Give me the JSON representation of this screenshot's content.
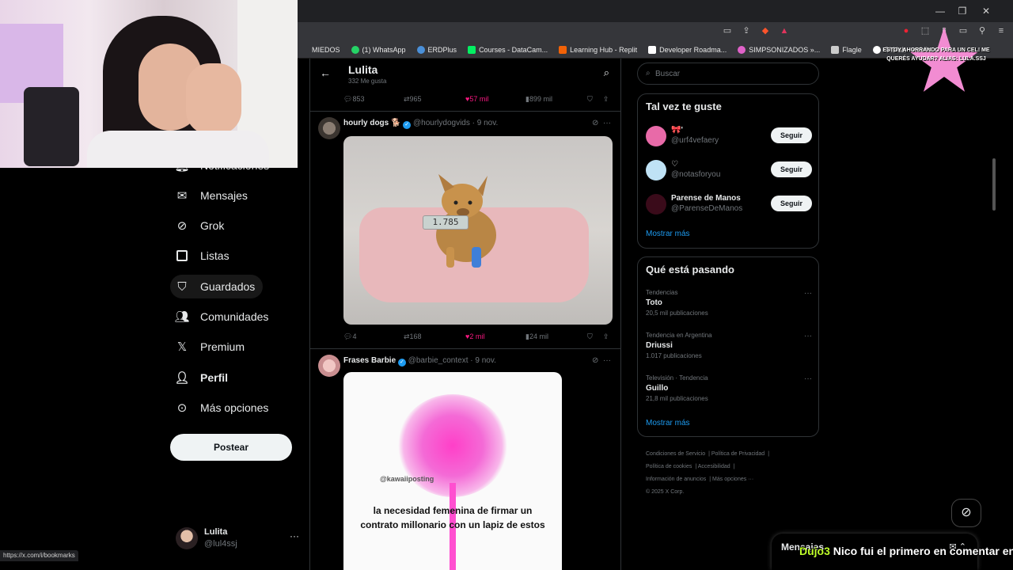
{
  "browser": {
    "bookmarks": [
      {
        "label": "MIEDOS",
        "color": "#35363a"
      },
      {
        "label": "(1) WhatsApp",
        "color": "#25d366"
      },
      {
        "label": "ERDPlus",
        "color": "#4a90d9"
      },
      {
        "label": "Courses - DataCam...",
        "color": "#03ef62"
      },
      {
        "label": "Learning Hub - Replit",
        "color": "#f26207"
      },
      {
        "label": "Developer Roadma...",
        "color": "#ffffff"
      },
      {
        "label": "SIMPSONIZADOS »...",
        "color": "#e062c9"
      },
      {
        "label": "Flagle",
        "color": "#cccccc"
      },
      {
        "label": "GitHub - public-apis...",
        "color": "#ffffff"
      }
    ],
    "status_url": "https://x.com/i/bookmarks"
  },
  "nav": {
    "items": [
      {
        "label": "Notificaciones",
        "icon": "bell-icon"
      },
      {
        "label": "Mensajes",
        "icon": "envelope-icon"
      },
      {
        "label": "Grok",
        "icon": "grok-icon"
      },
      {
        "label": "Listas",
        "icon": "list-icon"
      },
      {
        "label": "Guardados",
        "icon": "bookmark-icon"
      },
      {
        "label": "Comunidades",
        "icon": "people-icon"
      },
      {
        "label": "Premium",
        "icon": "x-logo-icon"
      },
      {
        "label": "Perfil",
        "icon": "person-icon"
      },
      {
        "label": "Más opciones",
        "icon": "more-circle-icon"
      }
    ],
    "post_button": "Postear",
    "profile": {
      "name": "Lulita",
      "handle": "@lul4ssj"
    }
  },
  "timeline": {
    "title": "Lulita",
    "subtitle": "332 Me gusta",
    "top_actions": {
      "replies": "853",
      "reposts": "965",
      "likes": "57 mil",
      "views": "899 mil"
    },
    "tweets": [
      {
        "name": "hourly dogs 🐕",
        "handle": "@hourlydogvids",
        "date": "· 9 nov.",
        "scale_reading": "1.785",
        "actions": {
          "replies": "4",
          "reposts": "168",
          "likes": "2 mil",
          "views": "24 mil"
        }
      },
      {
        "name": "Frases Barbie",
        "handle": "@barbie_context",
        "date": "· 9 nov.",
        "media_tag": "@kawaiiposting",
        "media_text": "la necesidad femenina de firmar un contrato millonario con un lapiz de estos"
      }
    ]
  },
  "right": {
    "search_placeholder": "Buscar",
    "who_to_follow": {
      "title": "Tal vez te guste",
      "users": [
        {
          "name": "🎀'",
          "handle": "@urf4vefaery",
          "avatar_color": "#e86aa8",
          "button": "Seguir"
        },
        {
          "name": "♡",
          "handle": "@notasforyou",
          "avatar_color": "#bfe2f5",
          "button": "Seguir"
        },
        {
          "name": "Parense de Manos",
          "handle": "@ParenseDeManos",
          "avatar_color": "#3a0b1a",
          "button": "Seguir"
        }
      ],
      "more": "Mostrar más"
    },
    "trends": {
      "title": "Qué está pasando",
      "items": [
        {
          "category": "Tendencias",
          "name": "Toto",
          "count": "20,5 mil publicaciones"
        },
        {
          "category": "Tendencia en Argentina",
          "name": "Driussi",
          "count": "1.017 publicaciones"
        },
        {
          "category": "Televisión · Tendencia",
          "name": "Guillo",
          "count": "21,8 mil publicaciones"
        }
      ],
      "more": "Mostrar más"
    },
    "footer": [
      "Condiciones de Servicio",
      "Política de Privacidad",
      "Política de cookies",
      "Accesibilidad",
      "Información de anuncios",
      "Más opciones ···",
      "© 2025 X Corp."
    ]
  },
  "messages_drawer": {
    "title": "Mensajes"
  },
  "stream": {
    "chat_user": "Dujo3",
    "chat_message": "Nico fui el primero en comentar en",
    "donation_text": "ESTOY AHORRANDO PARA UN CEL! ME QUERÉS AYUDAR? ALIAS: LULA.SSJ"
  }
}
